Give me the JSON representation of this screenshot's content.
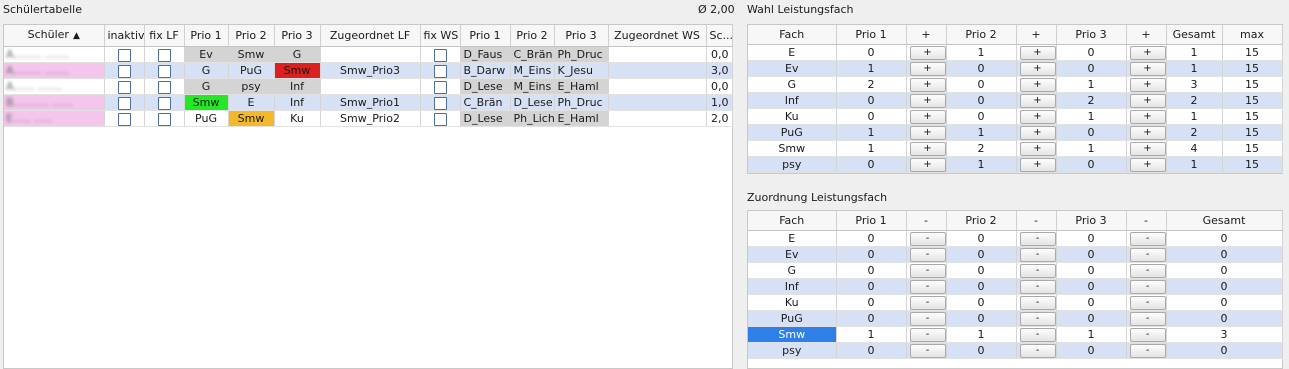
{
  "left": {
    "caption": "Schülertabelle",
    "average": "Ø 2,00",
    "headers": [
      "Schüler",
      "inaktiv",
      "fix LF",
      "Prio 1",
      "Prio 2",
      "Prio 3",
      "Zugeordnet LF",
      "fix WS",
      "Prio 1",
      "Prio 2",
      "Prio 3",
      "Zugeordnet WS",
      "Sc..."
    ],
    "rows": [
      {
        "name": "A........ .......",
        "lf1": "Ev",
        "lf2": "Smw",
        "lf3": "G",
        "zlf": "",
        "ws1": "D_Faus",
        "ws2": "C_Brän",
        "ws3": "Ph_Druc",
        "zws": "",
        "score": "0,0"
      },
      {
        "name": "A........ .......",
        "lf1": "G",
        "lf2": "PuG",
        "lf3": "Smw",
        "zlf": "Smw_Prio3",
        "ws1": "B_Darw",
        "ws2": "M_Eins",
        "ws3": "K_Jesu",
        "zws": "",
        "score": "3,0"
      },
      {
        "name": "A...... .......",
        "lf1": "G",
        "lf2": "psy",
        "lf3": "Inf",
        "zlf": "",
        "ws1": "D_Lese",
        "ws2": "M_Eins",
        "ws3": "E_Haml",
        "zws": "",
        "score": "0,0"
      },
      {
        "name": "B.......... ......",
        "lf1": "Smw",
        "lf2": "E",
        "lf3": "Inf",
        "zlf": "Smw_Prio1",
        "ws1": "C_Brän",
        "ws2": "D_Lese",
        "ws3": "Ph_Druc",
        "zws": "",
        "score": "1,0"
      },
      {
        "name": "E..... .....",
        "lf1": "PuG",
        "lf2": "Smw",
        "lf3": "Ku",
        "zlf": "Smw_Prio2",
        "ws1": "D_Lese",
        "ws2": "Ph_Lich",
        "ws3": "E_Haml",
        "zws": "",
        "score": "2,0"
      }
    ]
  },
  "wahl": {
    "caption": "Wahl Leistungsfach",
    "headers": [
      "Fach",
      "Prio 1",
      "+",
      "Prio 2",
      "+",
      "Prio 3",
      "+",
      "Gesamt",
      "max"
    ],
    "button_label": "+",
    "rows": [
      {
        "fach": "E",
        "p1": "0",
        "p2": "1",
        "p3": "0",
        "gesamt": "1",
        "max": "15"
      },
      {
        "fach": "Ev",
        "p1": "1",
        "p2": "0",
        "p3": "0",
        "gesamt": "1",
        "max": "15"
      },
      {
        "fach": "G",
        "p1": "2",
        "p2": "0",
        "p3": "1",
        "gesamt": "3",
        "max": "15"
      },
      {
        "fach": "Inf",
        "p1": "0",
        "p2": "0",
        "p3": "2",
        "gesamt": "2",
        "max": "15"
      },
      {
        "fach": "Ku",
        "p1": "0",
        "p2": "0",
        "p3": "1",
        "gesamt": "1",
        "max": "15"
      },
      {
        "fach": "PuG",
        "p1": "1",
        "p2": "1",
        "p3": "0",
        "gesamt": "2",
        "max": "15"
      },
      {
        "fach": "Smw",
        "p1": "1",
        "p2": "2",
        "p3": "1",
        "gesamt": "4",
        "max": "15"
      },
      {
        "fach": "psy",
        "p1": "0",
        "p2": "1",
        "p3": "0",
        "gesamt": "1",
        "max": "15"
      }
    ]
  },
  "zuordnung": {
    "caption": "Zuordnung Leistungsfach",
    "headers": [
      "Fach",
      "Prio 1",
      "-",
      "Prio 2",
      "-",
      "Prio 3",
      "-",
      "Gesamt"
    ],
    "button_label": "-",
    "selected_row": "Smw",
    "rows": [
      {
        "fach": "E",
        "p1": "0",
        "p2": "0",
        "p3": "0",
        "gesamt": "0"
      },
      {
        "fach": "Ev",
        "p1": "0",
        "p2": "0",
        "p3": "0",
        "gesamt": "0"
      },
      {
        "fach": "G",
        "p1": "0",
        "p2": "0",
        "p3": "0",
        "gesamt": "0"
      },
      {
        "fach": "Inf",
        "p1": "0",
        "p2": "0",
        "p3": "0",
        "gesamt": "0"
      },
      {
        "fach": "Ku",
        "p1": "0",
        "p2": "0",
        "p3": "0",
        "gesamt": "0"
      },
      {
        "fach": "PuG",
        "p1": "0",
        "p2": "0",
        "p3": "0",
        "gesamt": "0"
      },
      {
        "fach": "Smw",
        "p1": "1",
        "p2": "1",
        "p3": "1",
        "gesamt": "3"
      },
      {
        "fach": "psy",
        "p1": "0",
        "p2": "0",
        "p3": "0",
        "gesamt": "0"
      }
    ]
  },
  "colors": {
    "highlight_red": "#dd1f1f",
    "highlight_green": "#25e825",
    "highlight_orange": "#f4b92b",
    "selected_blue": "#2f7fe8",
    "row_alt": "#d7e1f5",
    "name_pink": "#f4c6ec"
  },
  "icons": {
    "sort": "sort-ascending-icon",
    "checkbox": "checkbox-icon"
  }
}
